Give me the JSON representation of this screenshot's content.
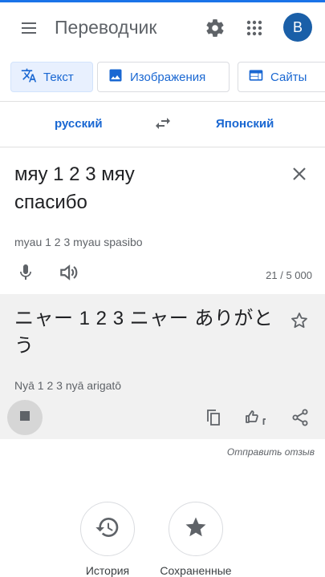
{
  "app": {
    "title": "Переводчик",
    "account_initial": "В",
    "accent_color": "#1a73e8",
    "avatar_color": "#1a5fa8"
  },
  "icons": {
    "menu": "menu-icon",
    "settings": "gear-icon",
    "apps": "apps-grid-icon",
    "swap": "swap-languages-icon",
    "clear": "close-icon",
    "mic": "microphone-icon",
    "speaker": "speaker-icon",
    "star": "star-outline-icon",
    "stop": "stop-icon",
    "copy": "copy-icon",
    "rate": "thumbs-rating-icon",
    "share": "share-icon",
    "history": "history-icon",
    "saved": "star-filled-icon"
  },
  "tabs": [
    {
      "label": "Текст",
      "icon": "translate-icon",
      "active": true
    },
    {
      "label": "Изображения",
      "icon": "image-icon",
      "active": false
    },
    {
      "label": "Сайты",
      "icon": "website-icon",
      "active": false
    }
  ],
  "languages": {
    "source": "русский",
    "target": "Японский"
  },
  "source": {
    "text": "мяу 1 2 3 мяу\nспасибо",
    "transliteration": "myau 1 2 3 myau spasibo",
    "char_count": "21 / 5 000"
  },
  "translation": {
    "text": "ニャー 1 2 3 ニャー ありがとう",
    "transliteration": "Nyā 1 2 3 nyā arigatō"
  },
  "feedback_label": "Отправить отзыв",
  "bottom": {
    "history_label": "История",
    "saved_label": "Сохраненные"
  }
}
